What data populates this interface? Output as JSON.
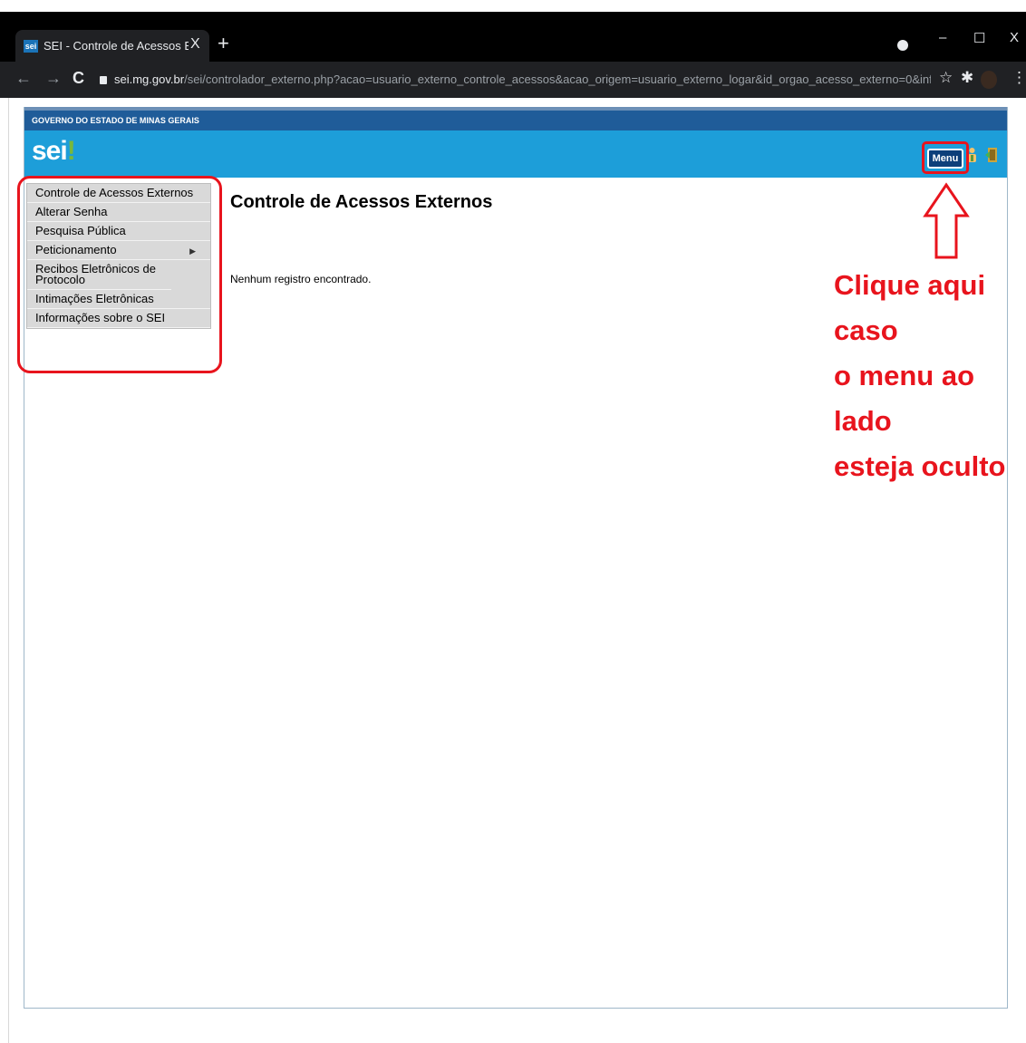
{
  "browser": {
    "tab_title": "SEI - Controle de Acessos Externo",
    "tab_close": "X",
    "new_tab": "+",
    "url_host": "sei.mg.gov.br",
    "url_path": "/sei/controlador_externo.php?acao=usuario_externo_controle_acessos&acao_origem=usuario_externo_logar&id_orgao_acesso_externo=0&infra_...",
    "window_controls": {
      "minimize": "–",
      "maximize": "☐",
      "close": "X"
    },
    "nav": {
      "back": "←",
      "forward": "→",
      "reload": "C"
    },
    "toolbar": {
      "star": "☆",
      "extensions": "✱"
    }
  },
  "header": {
    "gov_label": "GOVERNO DO ESTADO DE MINAS GERAIS",
    "logo_text": "sei",
    "logo_mark": "!",
    "menu_button": "Menu"
  },
  "sidebar": {
    "items": [
      {
        "label": "Controle de Acessos Externos"
      },
      {
        "label": "Alterar Senha"
      },
      {
        "label": "Pesquisa Pública"
      },
      {
        "label": "Peticionamento",
        "submenu_arrow": "▶"
      },
      {
        "label": "Recibos Eletrônicos de Protocolo"
      },
      {
        "label": "Intimações Eletrônicas"
      },
      {
        "label": "Informações sobre o SEI"
      }
    ]
  },
  "main": {
    "title": "Controle de Acessos Externos",
    "empty_message": "Nenhum registro encontrado."
  },
  "annotation": {
    "lines": [
      "Clique aqui caso",
      "o menu ao lado",
      "esteja oculto"
    ],
    "color": "#e8141d"
  },
  "colors": {
    "gov_bar": "#1f5c99",
    "sei_bar": "#1d9ed9",
    "menu_button": "#0d3f7a",
    "sidebar_bg": "#d9d9d9"
  }
}
